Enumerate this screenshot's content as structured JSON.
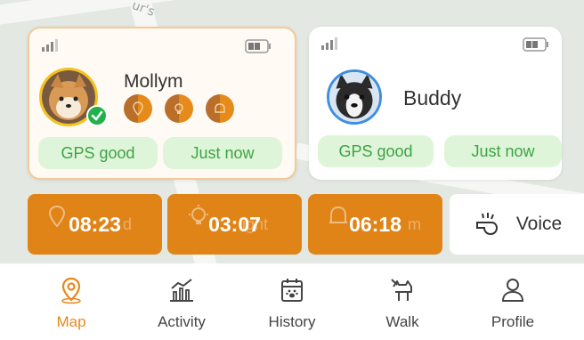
{
  "colors": {
    "accent": "#e08418",
    "gps_green": "#3da345",
    "pill_bg": "#dff5d9",
    "selected_border": "#f4c999"
  },
  "map": {
    "street_label": "ur's"
  },
  "pets": [
    {
      "name": "Mollym",
      "gps_status": "GPS good",
      "last_update": "Just now",
      "selected": true
    },
    {
      "name": "Buddy",
      "gps_status": "GPS good",
      "last_update": "Just now",
      "selected": false
    }
  ],
  "timers": [
    {
      "value": "08:23",
      "ghost_label": "d",
      "icon": "location-pin-icon"
    },
    {
      "value": "03:07",
      "ghost_label": "ight",
      "icon": "light-bulb-icon"
    },
    {
      "value": "06:18",
      "ghost_label": "m",
      "icon": "bell-icon"
    }
  ],
  "voice": {
    "label": "Voice",
    "icon": "whistle-icon"
  },
  "nav": {
    "items": [
      {
        "label": "Map",
        "icon": "map-pin-icon",
        "active": true
      },
      {
        "label": "Activity",
        "icon": "activity-chart-icon",
        "active": false
      },
      {
        "label": "History",
        "icon": "calendar-paw-icon",
        "active": false
      },
      {
        "label": "Walk",
        "icon": "dog-walk-icon",
        "active": false
      },
      {
        "label": "Profile",
        "icon": "person-icon",
        "active": false
      }
    ]
  }
}
